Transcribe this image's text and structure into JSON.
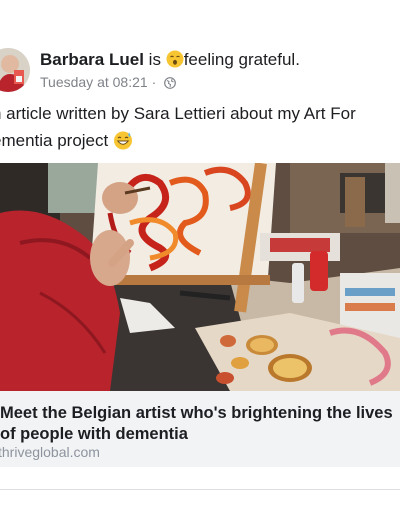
{
  "post": {
    "author": "Barbara Luel",
    "verb": "is",
    "feeling": "feeling grateful.",
    "timestamp": "Tuesday at 08:21",
    "separator_dot": "·",
    "audience_icon": "globe-icon",
    "text_line1": "n article written by Sara Lettieri about my Art For",
    "text_line2": "ementia project",
    "text_emoji": "grinning-sweat-emoji",
    "feeling_emoji": "relieved-face-emoji"
  },
  "link_preview": {
    "title_line1": "Meet the Belgian artist who's brightening the lives",
    "title_line2": "of people with dementia",
    "domain": "thriveglobal.com"
  },
  "colors": {
    "text": "#1c1e21",
    "meta": "#7f8389",
    "link_bg": "#f2f3f5",
    "domain": "#8d949e",
    "sweater": "#b8232c"
  }
}
